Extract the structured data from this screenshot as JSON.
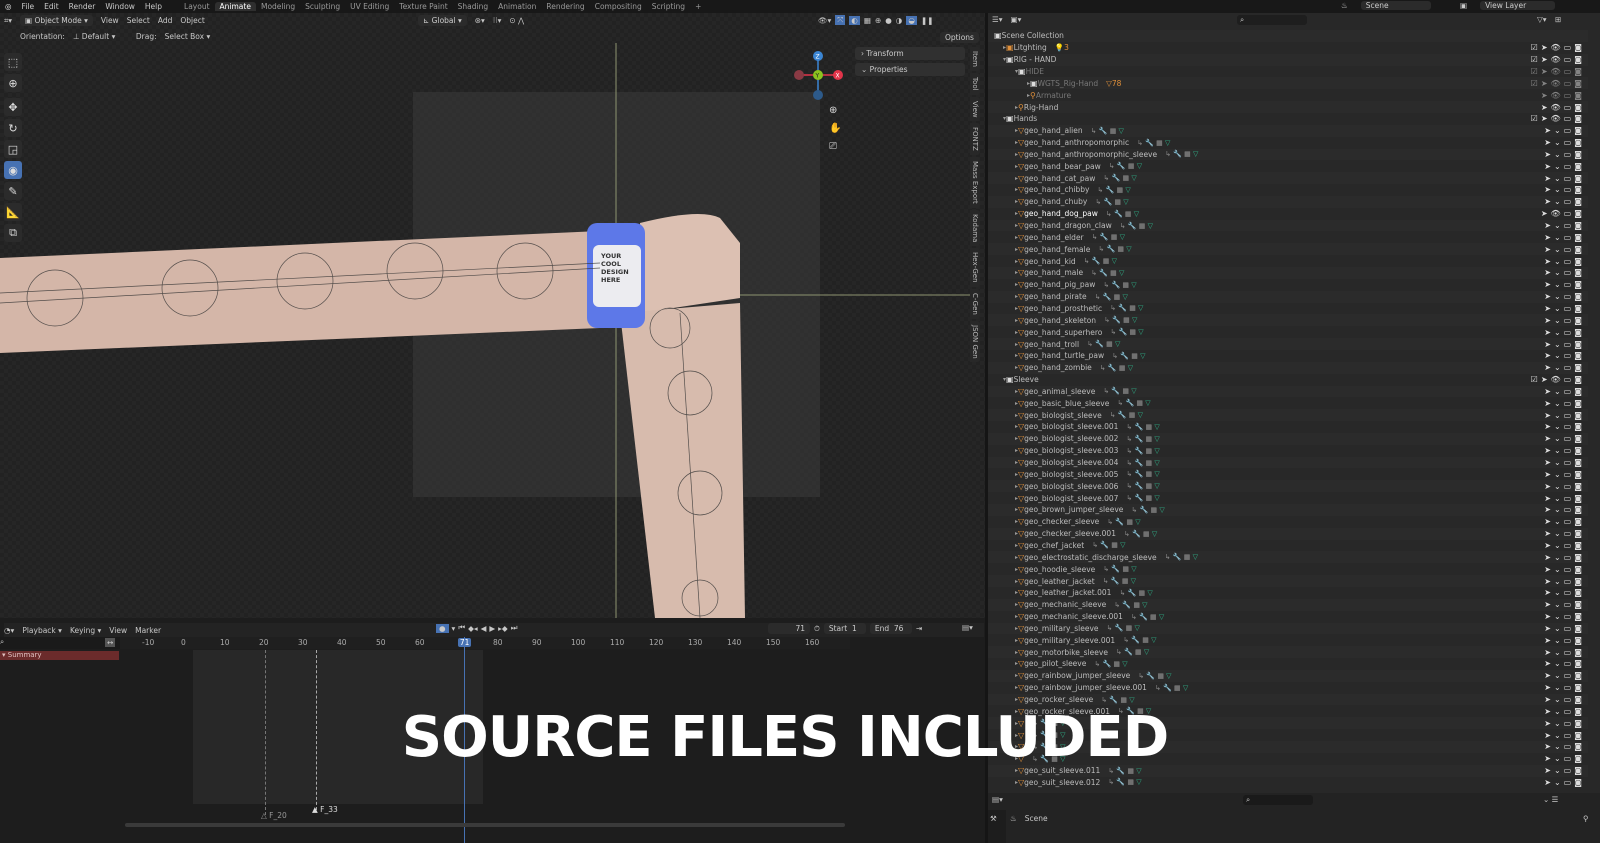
{
  "menu": [
    "File",
    "Edit",
    "Render",
    "Window",
    "Help"
  ],
  "workspaces": [
    "Layout",
    "Animate",
    "Modeling",
    "Sculpting",
    "UV Editing",
    "Texture Paint",
    "Shading",
    "Animation",
    "Rendering",
    "Compositing",
    "Scripting"
  ],
  "active_workspace": "Animate",
  "scene": "Scene",
  "view_layer": "View Layer",
  "viewport": {
    "mode": "Object Mode",
    "menus": [
      "View",
      "Select",
      "Add",
      "Object"
    ],
    "transform_orientation": "Global",
    "orientation_label": "Orientation:",
    "orientation_value": "Default",
    "drag_label": "Drag:",
    "drag_value": "Select Box",
    "options": "Options",
    "panels": [
      "Transform",
      "Properties"
    ],
    "side_tabs": [
      "Item",
      "Tool",
      "View",
      "FONTZ",
      "Mass Export",
      "Kodama",
      "Hex-Gen",
      "C-Gen",
      "JSON Gen"
    ],
    "gizmo": {
      "z": "Z",
      "y": "Y",
      "x": "X"
    },
    "watch_text": [
      "YOUR",
      "COOL",
      "DESIGN",
      "HERE"
    ],
    "tools": [
      "select-box",
      "cursor",
      "move",
      "rotate",
      "scale",
      "transform",
      "annotate",
      "measure",
      "add-cube"
    ],
    "active_tool": "transform"
  },
  "timeline": {
    "menus": [
      "Playback",
      "Keying",
      "View",
      "Marker"
    ],
    "current_frame": "71",
    "start_label": "Start",
    "start": "1",
    "end_label": "End",
    "end": "76",
    "ruler": [
      "-10",
      "0",
      "10",
      "20",
      "30",
      "40",
      "50",
      "60",
      "71",
      "80",
      "90",
      "100",
      "110",
      "120",
      "130",
      "140",
      "150",
      "160"
    ],
    "summary": "Summary",
    "markers": [
      "F_20",
      "F_33"
    ]
  },
  "outliner": {
    "rows": [
      {
        "name": "Scene Collection",
        "depth": 0,
        "type": "col",
        "arrow": ""
      },
      {
        "name": "Litghting",
        "depth": 1,
        "type": "colo",
        "arrow": "▸",
        "extra": "💡3"
      },
      {
        "name": "RIG - HAND",
        "depth": 1,
        "type": "col",
        "arrow": "▾"
      },
      {
        "name": "HIDE",
        "depth": 2,
        "type": "col",
        "arrow": "▾",
        "dim": true
      },
      {
        "name": "WGTS_Rig-Hand",
        "depth": 3,
        "type": "col",
        "arrow": "▸",
        "dim": true,
        "extra": "▽78"
      },
      {
        "name": "Armature",
        "depth": 3,
        "type": "arm",
        "arrow": "▸",
        "dim": true
      },
      {
        "name": "Rig-Hand",
        "depth": 2,
        "type": "arm",
        "arrow": "▸"
      },
      {
        "name": "Hands",
        "depth": 1,
        "type": "col",
        "arrow": "▾"
      },
      {
        "name": "geo_hand_alien",
        "depth": 2,
        "type": "mesh"
      },
      {
        "name": "geo_hand_anthropomorphic",
        "depth": 2,
        "type": "mesh"
      },
      {
        "name": "geo_hand_anthropomorphic_sleeve",
        "depth": 2,
        "type": "mesh"
      },
      {
        "name": "geo_hand_bear_paw",
        "depth": 2,
        "type": "mesh"
      },
      {
        "name": "geo_hand_cat_paw",
        "depth": 2,
        "type": "mesh"
      },
      {
        "name": "geo_hand_chibby",
        "depth": 2,
        "type": "mesh"
      },
      {
        "name": "geo_hand_chuby",
        "depth": 2,
        "type": "mesh"
      },
      {
        "name": "geo_hand_dog_paw",
        "depth": 2,
        "type": "mesh",
        "bold": true
      },
      {
        "name": "geo_hand_dragon_claw",
        "depth": 2,
        "type": "mesh"
      },
      {
        "name": "geo_hand_elder",
        "depth": 2,
        "type": "mesh"
      },
      {
        "name": "geo_hand_female",
        "depth": 2,
        "type": "mesh"
      },
      {
        "name": "geo_hand_kid",
        "depth": 2,
        "type": "mesh"
      },
      {
        "name": "geo_hand_male",
        "depth": 2,
        "type": "mesh"
      },
      {
        "name": "geo_hand_pig_paw",
        "depth": 2,
        "type": "mesh"
      },
      {
        "name": "geo_hand_pirate",
        "depth": 2,
        "type": "mesh"
      },
      {
        "name": "geo_hand_prosthetic",
        "depth": 2,
        "type": "mesh"
      },
      {
        "name": "geo_hand_skeleton",
        "depth": 2,
        "type": "mesh"
      },
      {
        "name": "geo_hand_superhero",
        "depth": 2,
        "type": "mesh"
      },
      {
        "name": "geo_hand_troll",
        "depth": 2,
        "type": "mesh"
      },
      {
        "name": "geo_hand_turtle_paw",
        "depth": 2,
        "type": "mesh"
      },
      {
        "name": "geo_hand_zombie",
        "depth": 2,
        "type": "mesh"
      },
      {
        "name": "Sleeve",
        "depth": 1,
        "type": "col",
        "arrow": "▾"
      },
      {
        "name": "geo_animal_sleeve",
        "depth": 2,
        "type": "mesh"
      },
      {
        "name": "geo_basic_blue_sleeve",
        "depth": 2,
        "type": "mesh"
      },
      {
        "name": "geo_biologist_sleeve",
        "depth": 2,
        "type": "mesh"
      },
      {
        "name": "geo_biologist_sleeve.001",
        "depth": 2,
        "type": "mesh"
      },
      {
        "name": "geo_biologist_sleeve.002",
        "depth": 2,
        "type": "mesh"
      },
      {
        "name": "geo_biologist_sleeve.003",
        "depth": 2,
        "type": "mesh"
      },
      {
        "name": "geo_biologist_sleeve.004",
        "depth": 2,
        "type": "mesh"
      },
      {
        "name": "geo_biologist_sleeve.005",
        "depth": 2,
        "type": "mesh"
      },
      {
        "name": "geo_biologist_sleeve.006",
        "depth": 2,
        "type": "mesh"
      },
      {
        "name": "geo_biologist_sleeve.007",
        "depth": 2,
        "type": "mesh"
      },
      {
        "name": "geo_brown_jumper_sleeve",
        "depth": 2,
        "type": "mesh"
      },
      {
        "name": "geo_checker_sleeve",
        "depth": 2,
        "type": "mesh"
      },
      {
        "name": "geo_checker_sleeve.001",
        "depth": 2,
        "type": "mesh"
      },
      {
        "name": "geo_chef_jacket",
        "depth": 2,
        "type": "mesh"
      },
      {
        "name": "geo_electrostatic_discharge_sleeve",
        "depth": 2,
        "type": "mesh"
      },
      {
        "name": "geo_hoodie_sleeve",
        "depth": 2,
        "type": "mesh"
      },
      {
        "name": "geo_leather_jacket",
        "depth": 2,
        "type": "mesh"
      },
      {
        "name": "geo_leather_jacket.001",
        "depth": 2,
        "type": "mesh"
      },
      {
        "name": "geo_mechanic_sleeve",
        "depth": 2,
        "type": "mesh"
      },
      {
        "name": "geo_mechanic_sleeve.001",
        "depth": 2,
        "type": "mesh"
      },
      {
        "name": "geo_military_sleeve",
        "depth": 2,
        "type": "mesh"
      },
      {
        "name": "geo_military_sleeve.001",
        "depth": 2,
        "type": "mesh"
      },
      {
        "name": "geo_motorbike_sleeve",
        "depth": 2,
        "type": "mesh"
      },
      {
        "name": "geo_pilot_sleeve",
        "depth": 2,
        "type": "mesh"
      },
      {
        "name": "geo_rainbow_jumper_sleeve",
        "depth": 2,
        "type": "mesh"
      },
      {
        "name": "geo_rainbow_jumper_sleeve.001",
        "depth": 2,
        "type": "mesh"
      },
      {
        "name": "geo_rocker_sleeve",
        "depth": 2,
        "type": "mesh"
      },
      {
        "name": "geo_rocker_sleeve.001",
        "depth": 2,
        "type": "mesh"
      },
      {
        "name": "",
        "depth": 2,
        "type": "mesh"
      },
      {
        "name": "",
        "depth": 2,
        "type": "mesh"
      },
      {
        "name": "",
        "depth": 2,
        "type": "mesh"
      },
      {
        "name": "",
        "depth": 2,
        "type": "mesh"
      },
      {
        "name": "geo_suit_sleeve.011",
        "depth": 2,
        "type": "mesh"
      },
      {
        "name": "geo_suit_sleeve.012",
        "depth": 2,
        "type": "mesh"
      }
    ]
  },
  "properties": {
    "context": "Scene"
  },
  "overlay_caption": "SOURCE FILES INCLUDED",
  "colors": {
    "accent": "#4772b3",
    "mesh_icon": "#e0903a",
    "gizmo_x": "#e2344a",
    "gizmo_y": "#8bc31f",
    "gizmo_z": "#3b85d3",
    "skin": "#d9bcae",
    "watch": "#5d78e8"
  }
}
